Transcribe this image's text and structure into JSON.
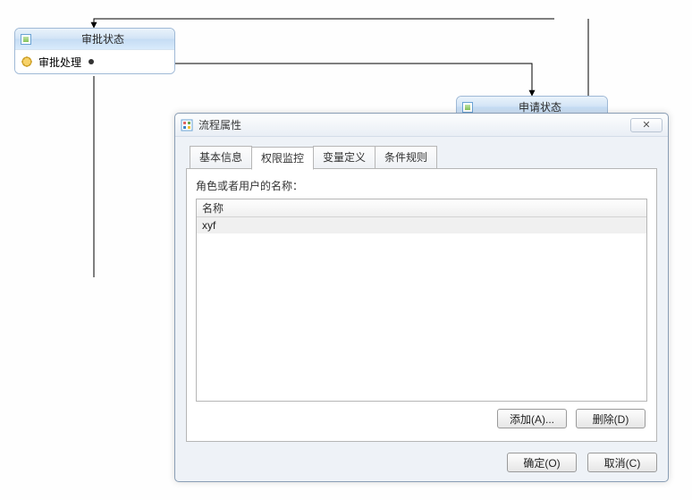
{
  "diagram": {
    "node_approve": {
      "title": "审批状态",
      "action": "审批处理"
    },
    "node_apply": {
      "title": "申请状态"
    }
  },
  "dialog": {
    "title": "流程属性",
    "tabs": {
      "basic": "基本信息",
      "permission": "权限监控",
      "variable": "变量定义",
      "rules": "条件规则"
    },
    "permission": {
      "section_label": "角色或者用户的名称：",
      "column_header": "名称",
      "rows": [
        "xyf"
      ],
      "add_button": "添加(A)...",
      "delete_button": "删除(D)"
    },
    "ok_button": "确定(O)",
    "cancel_button": "取消(C)"
  }
}
